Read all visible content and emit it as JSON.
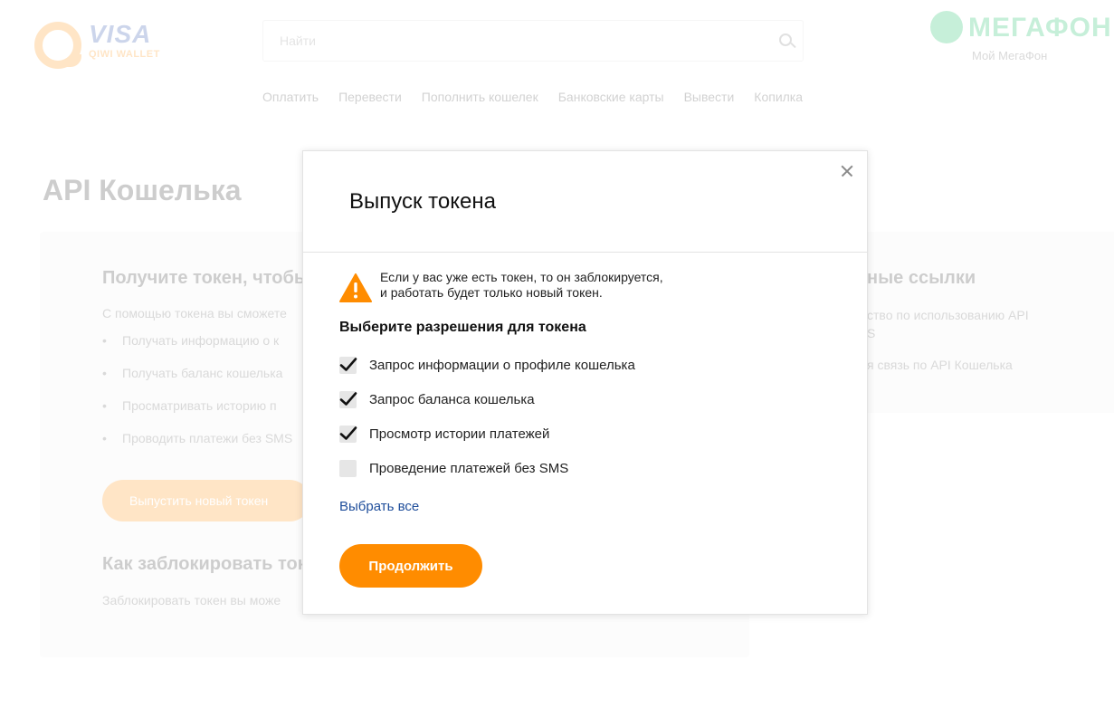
{
  "header": {
    "logo_title": "VISA",
    "logo_subtitle": "QIWI WALLET",
    "search_placeholder": "Найти",
    "partner_name": "МЕГАФОН",
    "partner_sub": "Мой МегаФон",
    "nav": [
      "Оплатить",
      "Перевести",
      "Пополнить кошелек",
      "Банковские карты",
      "Вывести",
      "Копилка"
    ]
  },
  "page": {
    "title": "API Кошелька",
    "card_heading": "Получите токен, чтобы",
    "card_text": "С помощью токена вы сможете",
    "bullets": [
      "Получать информацию о к",
      "Получать баланс кошелька",
      "Просматривать историю п",
      "Проводить платежи без SMS"
    ],
    "card_button": "Выпустить новый токен",
    "block_heading": "Как заблокировать токен",
    "block_text": "Заблокировать токен вы може",
    "side_heading": "ные ссылки",
    "side_links": [
      "ство по использованию API",
      "S",
      "я связь по API Кошелька"
    ]
  },
  "modal": {
    "title": "Выпуск токена",
    "warning_line1": "Если у вас уже есть токен, то он заблокируется,",
    "warning_line2": "и работать будет только новый токен.",
    "section_heading": "Выберите разрешения для токена",
    "permissions": [
      {
        "label": "Запрос информации о профиле кошелька",
        "checked": true
      },
      {
        "label": "Запрос баланса кошелька",
        "checked": true
      },
      {
        "label": "Просмотр истории платежей",
        "checked": true
      },
      {
        "label": "Проведение платежей без SMS",
        "checked": false
      }
    ],
    "select_all": "Выбрать все",
    "continue_label": "Продолжить"
  },
  "colors": {
    "accent": "#ff8c00",
    "link": "#1f4e9b"
  }
}
